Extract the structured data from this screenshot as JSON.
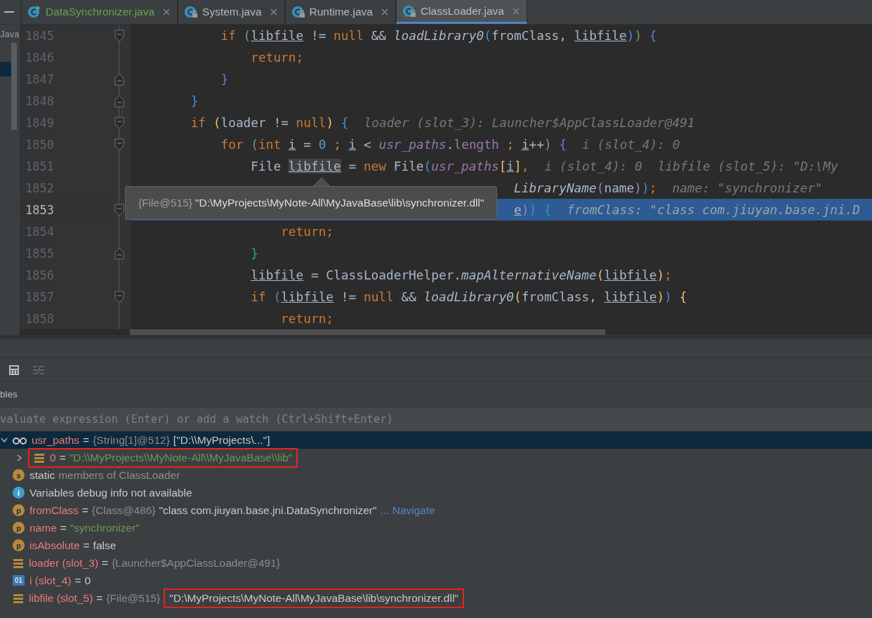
{
  "tabs": [
    {
      "label": "DataSynchronizer.java",
      "selected": false,
      "locked": false,
      "color": "#62a64f"
    },
    {
      "label": "System.java",
      "selected": false,
      "locked": true,
      "color": "#bbbbbb"
    },
    {
      "label": "Runtime.java",
      "selected": false,
      "locked": true,
      "color": "#bbbbbb"
    },
    {
      "label": "ClassLoader.java",
      "selected": true,
      "locked": true,
      "color": "#bbbbbb"
    }
  ],
  "sidebar": {
    "label": "Java"
  },
  "editor": {
    "lines": [
      {
        "number": "1845",
        "current": false,
        "kind": "opener",
        "tokens": [
          {
            "kind": "kw",
            "text": "            if "
          },
          {
            "kind": "bracket",
            "text": "(",
            "color": "#5fa86a"
          },
          {
            "kind": "var",
            "text": "libfile"
          },
          {
            "kind": "text",
            "text": " != "
          },
          {
            "kind": "kw",
            "text": "null"
          },
          {
            "kind": "text",
            "text": " && "
          },
          {
            "kind": "call",
            "text": "loadLibrary0"
          },
          {
            "kind": "bracket",
            "text": "(",
            "color": "#3d8fe0"
          },
          {
            "kind": "text",
            "text": "fromClass, "
          },
          {
            "kind": "var",
            "text": "libfile"
          },
          {
            "kind": "bracket",
            "text": ")",
            "color": "#3d8fe0"
          },
          {
            "kind": "bracket",
            "text": ")",
            "color": "#5fa86a"
          },
          {
            "kind": "bracket",
            "text": " {",
            "color": "#5f7fd0"
          }
        ]
      },
      {
        "number": "1846",
        "current": false,
        "kind": "plain",
        "tokens": [
          {
            "kind": "kw",
            "text": "                return;"
          }
        ]
      },
      {
        "number": "1847",
        "current": false,
        "kind": "closer",
        "tokens": [
          {
            "kind": "bracket",
            "text": "            }",
            "color": "#5f7fd0"
          }
        ]
      },
      {
        "number": "1848",
        "current": false,
        "kind": "closer",
        "tokens": [
          {
            "kind": "bracket",
            "text": "        }",
            "color": "#3d8fe0"
          }
        ]
      },
      {
        "number": "1849",
        "current": false,
        "kind": "opener",
        "tokens": [
          {
            "kind": "kw",
            "text": "        if "
          },
          {
            "kind": "bracket",
            "text": "(",
            "color": "#e8bf6a"
          },
          {
            "kind": "text",
            "text": "loader != "
          },
          {
            "kind": "kw",
            "text": "null"
          },
          {
            "kind": "bracket",
            "text": ")",
            "color": "#e8bf6a"
          },
          {
            "kind": "bracket",
            "text": " {",
            "color": "#3d8fe0"
          }
        ],
        "hints": [
          "loader (slot_3): Launcher$AppClassLoader@491"
        ]
      },
      {
        "number": "1850",
        "current": false,
        "kind": "opener",
        "tokens": [
          {
            "kind": "kw",
            "text": "            for "
          },
          {
            "kind": "bracket",
            "text": "(",
            "color": "#5fa86a"
          },
          {
            "kind": "kw",
            "text": "int "
          },
          {
            "kind": "var",
            "text": "i"
          },
          {
            "kind": "text",
            "text": " = "
          },
          {
            "kind": "num",
            "text": "0"
          },
          {
            "kind": "kw",
            "text": " ; "
          },
          {
            "kind": "var",
            "text": "i"
          },
          {
            "kind": "text",
            "text": " < "
          },
          {
            "kind": "field",
            "text": "usr_paths"
          },
          {
            "kind": "text",
            "text": "."
          },
          {
            "kind": "prop",
            "text": "length"
          },
          {
            "kind": "kw",
            "text": " ; "
          },
          {
            "kind": "var",
            "text": "i"
          },
          {
            "kind": "text",
            "text": "++"
          },
          {
            "kind": "bracket",
            "text": ")",
            "color": "#5fa86a"
          },
          {
            "kind": "bracket",
            "text": " {",
            "color": "#6d77d0"
          }
        ],
        "hints": [
          "i (slot_4): 0"
        ]
      },
      {
        "number": "1851",
        "current": false,
        "kind": "plain",
        "tokens": [
          {
            "kind": "text",
            "text": "                File "
          },
          {
            "kind": "hover",
            "text": "libfile"
          },
          {
            "kind": "text",
            "text": " = "
          },
          {
            "kind": "kw",
            "text": "new"
          },
          {
            "kind": "text",
            "text": " File"
          },
          {
            "kind": "bracket",
            "text": "(",
            "color": "#3d8fe0"
          },
          {
            "kind": "field",
            "text": "usr_paths"
          },
          {
            "kind": "bracket",
            "text": "[",
            "color": "#e8bf6a"
          },
          {
            "kind": "var",
            "text": "i"
          },
          {
            "kind": "bracket",
            "text": "]",
            "color": "#e8bf6a"
          },
          {
            "kind": "kw",
            "text": ","
          }
        ],
        "hints": [
          "i (slot_4): 0",
          "libfile (slot_5): \"D:\\My"
        ]
      },
      {
        "number": "1852",
        "current": false,
        "kind": "plain",
        "tokens": [
          {
            "kind": "call",
            "text": "                                                   LibraryName"
          },
          {
            "kind": "bracket",
            "text": "(",
            "color": "#9b7fd0"
          },
          {
            "kind": "text",
            "text": "name"
          },
          {
            "kind": "bracket",
            "text": ")",
            "color": "#9b7fd0"
          },
          {
            "kind": "bracket",
            "text": ")",
            "color": "#3d8fe0"
          },
          {
            "kind": "kw",
            "text": ";"
          }
        ],
        "hints": [
          "name: \"synchronizer\""
        ]
      },
      {
        "number": "1853",
        "current": true,
        "kind": "opener",
        "tokens": [
          {
            "kind": "var",
            "text": "                                                   e"
          },
          {
            "kind": "bracket",
            "text": ")",
            "color": "#9b7fd0"
          },
          {
            "kind": "bracket",
            "text": ")",
            "color": "#3d8fe0"
          },
          {
            "kind": "bracket",
            "text": " {",
            "color": "#2aa198"
          }
        ],
        "hints": [
          "fromClass: \"class com.jiuyan.base.jni.D"
        ]
      },
      {
        "number": "1854",
        "current": false,
        "kind": "plain",
        "tokens": [
          {
            "kind": "kw",
            "text": "                    return;"
          }
        ]
      },
      {
        "number": "1855",
        "current": false,
        "kind": "closer",
        "tokens": [
          {
            "kind": "bracket",
            "text": "                }",
            "color": "#2aa198"
          }
        ]
      },
      {
        "number": "1856",
        "current": false,
        "kind": "plain",
        "tokens": [
          {
            "kind": "var",
            "text": "                libfile"
          },
          {
            "kind": "text",
            "text": " = ClassLoaderHelper."
          },
          {
            "kind": "call",
            "text": "mapAlternativeName"
          },
          {
            "kind": "bracket",
            "text": "(",
            "color": "#e8bf6a"
          },
          {
            "kind": "var",
            "text": "libfile"
          },
          {
            "kind": "bracket",
            "text": ")",
            "color": "#e8bf6a"
          },
          {
            "kind": "kw",
            "text": ";"
          }
        ]
      },
      {
        "number": "1857",
        "current": false,
        "kind": "opener",
        "tokens": [
          {
            "kind": "kw",
            "text": "                if "
          },
          {
            "kind": "bracket",
            "text": "(",
            "color": "#3d8fe0"
          },
          {
            "kind": "var",
            "text": "libfile"
          },
          {
            "kind": "text",
            "text": " != "
          },
          {
            "kind": "kw",
            "text": "null"
          },
          {
            "kind": "text",
            "text": " && "
          },
          {
            "kind": "call",
            "text": "loadLibrary0"
          },
          {
            "kind": "bracket",
            "text": "(",
            "color": "#e8bf6a"
          },
          {
            "kind": "text",
            "text": "fromClass, "
          },
          {
            "kind": "var",
            "text": "libfile"
          },
          {
            "kind": "bracket",
            "text": ")",
            "color": "#e8bf6a"
          },
          {
            "kind": "bracket",
            "text": ")",
            "color": "#3d8fe0"
          },
          {
            "kind": "bracket",
            "text": " {",
            "color": "#e8bf6a"
          }
        ]
      },
      {
        "number": "1858",
        "current": false,
        "kind": "plain",
        "tokens": [
          {
            "kind": "kw",
            "text": "                    return;"
          }
        ]
      }
    ]
  },
  "tooltip": {
    "type": "{File@515}",
    "value": "\"D:\\MyProjects\\MyNote-All\\MyJavaBase\\lib\\synchronizer.dll\""
  },
  "debugger": {
    "tab": "bles",
    "evaluate": {
      "placeholder": "valuate expression (Enter) or add a watch (Ctrl+Shift+Enter)"
    },
    "variables": [
      {
        "kind": "watch",
        "expanded": true,
        "selected": true,
        "name": "usr_paths",
        "separator": "=",
        "type": "{String[1]@512}",
        "value": "[\"D:\\\\MyProjects\\...\"]",
        "string": false,
        "children": [
          {
            "kind": "element",
            "expanded": false,
            "selected": false,
            "name": "0",
            "separator": "=",
            "value": "\"D:\\\\MyProjects\\\\MyNote-All\\\\MyJavaBase\\\\lib\"",
            "string": true,
            "marked": true
          }
        ]
      },
      {
        "kind": "static",
        "badge": "s",
        "selected": false,
        "name": "static",
        "note": "members of ClassLoader"
      },
      {
        "kind": "info",
        "badge": "i",
        "selected": false,
        "text": "Variables debug info not available"
      },
      {
        "kind": "param",
        "badge": "p",
        "selected": false,
        "name": "fromClass",
        "separator": "=",
        "type": "{Class@486}",
        "value": "\"class com.jiuyan.base.jni.DataSynchronizer\"",
        "string": false,
        "link": "... Navigate"
      },
      {
        "kind": "param",
        "badge": "p",
        "selected": false,
        "name": "name",
        "separator": "=",
        "value": "\"synchronizer\"",
        "string": true
      },
      {
        "kind": "param",
        "badge": "p",
        "selected": false,
        "name": "isAbsolute",
        "separator": "=",
        "value": "false",
        "string": false
      },
      {
        "kind": "local",
        "selected": false,
        "name": "loader (slot_3)",
        "separator": "=",
        "type": "{Launcher$AppClassLoader@491}"
      },
      {
        "kind": "primitive",
        "badge": "01",
        "selected": false,
        "name": "i (slot_4)",
        "separator": "=",
        "value": "0",
        "string": false
      },
      {
        "kind": "local",
        "selected": false,
        "name": "libfile (slot_5)",
        "separator": "=",
        "type": "{File@515}",
        "value": "\"D:\\MyProjects\\MyNote-All\\MyJavaBase\\lib\\synchronizer.dll\"",
        "string": false,
        "marked": true
      }
    ]
  }
}
